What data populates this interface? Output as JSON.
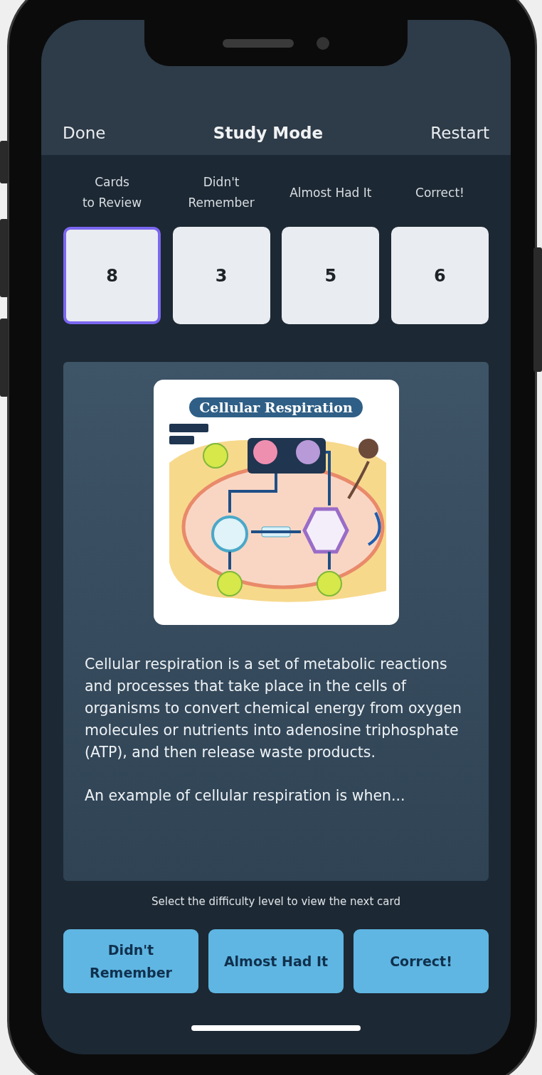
{
  "nav": {
    "left": "Done",
    "title": "Study Mode",
    "right": "Restart"
  },
  "counters": [
    {
      "label": "Cards\nto Review",
      "value": "8",
      "selected": true
    },
    {
      "label": "Didn't\nRemember",
      "value": "3",
      "selected": false
    },
    {
      "label": "Almost Had It",
      "value": "5",
      "selected": false
    },
    {
      "label": "Correct!",
      "value": "6",
      "selected": false
    }
  ],
  "card": {
    "image_title": "Cellular Respiration",
    "paragraphs": [
      "Cellular respiration is a set of metabolic reactions and processes that take place in the cells of organisms to convert chemical energy from oxygen molecules or nutrients into adenosine triphosphate (ATP), and then release waste products.",
      "An example of cellular respiration is when..."
    ]
  },
  "hint": "Select the difficulty level to view the next card",
  "buttons": [
    "Didn't\nRemember",
    "Almost Had It",
    "Correct!"
  ]
}
